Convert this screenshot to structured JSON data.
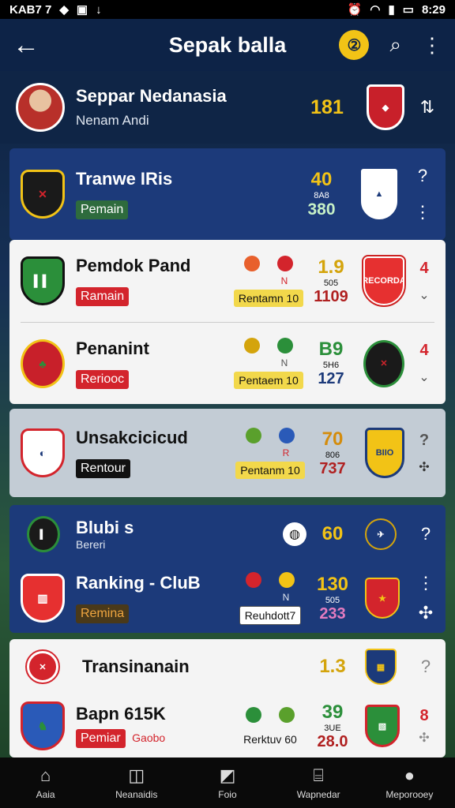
{
  "status": {
    "left_text": "KAB7 7",
    "time": "8:29"
  },
  "appbar": {
    "title": "Sepak balla",
    "yellow_glyph": "②"
  },
  "profile": {
    "name": "Seppar Nedanasia",
    "sub": "Nenam Andi",
    "score": "181"
  },
  "card1": {
    "name": "Tranwe IRis",
    "tag": "Pemain",
    "top": "40",
    "mid": "8A8",
    "bottom": "380",
    "q": "?"
  },
  "card2": {
    "row1": {
      "name": "Pemdok Pand",
      "tag": "Ramain",
      "label": "Rentamn 10",
      "top": "1.9",
      "mid": "505",
      "bottom": "1109",
      "right": "4",
      "small": "N",
      "badge_text": "RECORDA"
    },
    "row2": {
      "name": "Penanint",
      "tag": "Reriooc",
      "label": "Pentaem 10",
      "top": "B9",
      "mid": "5H6",
      "bottom": "127",
      "right": "4",
      "small": "N"
    }
  },
  "card3": {
    "name": "Unsakcicicud",
    "tag": "Rentour",
    "label": "Pentanm 10",
    "top": "70",
    "mid": "806",
    "bottom": "737",
    "right": "?",
    "small": "R",
    "badge_text": "BIIO"
  },
  "card4": {
    "row1": {
      "name": "Blubi s",
      "sub": "Bereri",
      "top": "60",
      "right": "?"
    },
    "row2": {
      "name": "Ranking - CluB",
      "tag": "Remina",
      "label": "Reuhdott7",
      "top": "130",
      "mid": "505",
      "bottom": "233",
      "small": "N"
    }
  },
  "card5": {
    "row1": {
      "name": "Transinanain",
      "top": "1.3",
      "right": "?"
    },
    "row2": {
      "name": "Bapn 615K",
      "tag": "Pemiar",
      "tag2": "Gaobo",
      "label": "Rerktuv 60",
      "top": "39",
      "mid": "3UE",
      "bottom": "28.0",
      "right": "8"
    }
  },
  "nav": [
    {
      "label": "Aaia",
      "icon": "home-icon"
    },
    {
      "label": "Neanaidis",
      "icon": "camera-icon"
    },
    {
      "label": "Foio",
      "icon": "tag-icon"
    },
    {
      "label": "Wapnedar",
      "icon": "bag-icon"
    },
    {
      "label": "Meporooey",
      "icon": "person-icon"
    }
  ],
  "colors": {
    "accent_yellow": "#f2c316",
    "card_blue": "#1c3a7a",
    "red": "#d3242c"
  }
}
